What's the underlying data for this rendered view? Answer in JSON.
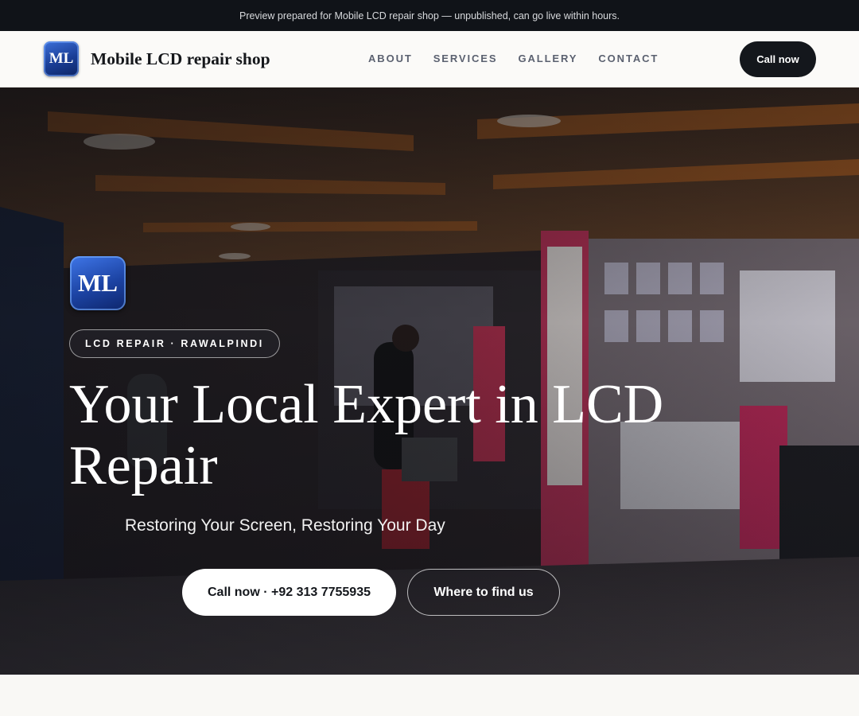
{
  "preview_banner": "Preview prepared for Mobile LCD repair shop — unpublished, can go live within hours.",
  "header": {
    "logo_text": "ML",
    "brand_name": "Mobile LCD repair shop",
    "nav": [
      "ABOUT",
      "SERVICES",
      "GALLERY",
      "CONTACT"
    ],
    "cta_label": "Call now"
  },
  "hero": {
    "logo_text": "ML",
    "tag": "LCD REPAIR · RAWALPINDI",
    "headline": "Your Local Expert in LCD Repair",
    "subheadline": "Restoring Your Screen, Restoring Your Day",
    "primary_button": "Call now · +92 313 7755935",
    "secondary_button": "Where to find us"
  },
  "colors": {
    "dark": "#14171c",
    "logo_blue": "#1a3d95",
    "banner_bg": "#101318"
  }
}
